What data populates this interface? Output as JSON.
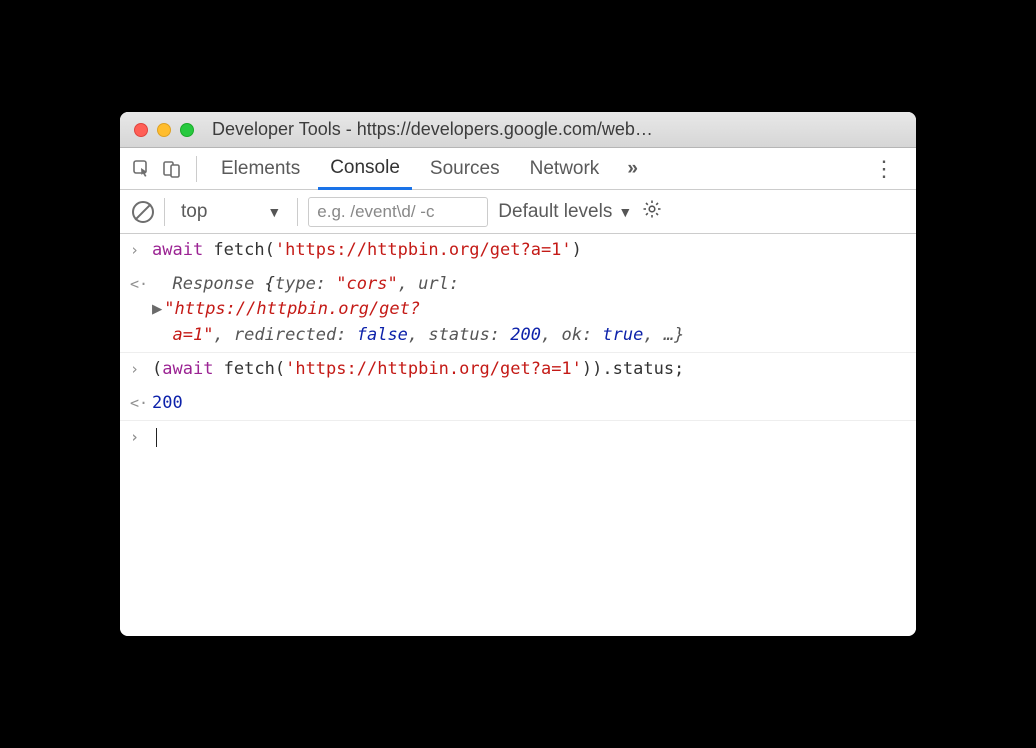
{
  "window": {
    "title": "Developer Tools - https://developers.google.com/web…"
  },
  "tabs": {
    "elements": "Elements",
    "console": "Console",
    "sources": "Sources",
    "network": "Network",
    "overflow": "»"
  },
  "toolbar": {
    "context": "top",
    "filter_placeholder": "e.g. /event\\d/ -c",
    "levels": "Default levels"
  },
  "console": {
    "line1": {
      "await": "await",
      "fn": " fetch(",
      "arg": "'https://httpbin.org/get?a=1'",
      "close": ")"
    },
    "line2": {
      "obj_start": "Response ",
      "brace_open": "{",
      "k_type": "type:",
      "v_type": " \"cors\"",
      "k_url": ", url:",
      "url_line1": "\"https://httpbin.org/get?",
      "url_line2": "a=1\"",
      "k_redirected": ", redirected:",
      "v_redirected": " false",
      "k_status": ", status:",
      "v_status": " 200",
      "k_ok": ", ok:",
      "v_ok": " true",
      "tail": ", …}"
    },
    "line3": {
      "open": "(",
      "await": "await",
      "fn": " fetch(",
      "arg": "'https://httpbin.org/get?a=1'",
      "close_inner": ")",
      "close_outer": ")",
      "prop": ".status;"
    },
    "line4": {
      "value": "200"
    }
  }
}
